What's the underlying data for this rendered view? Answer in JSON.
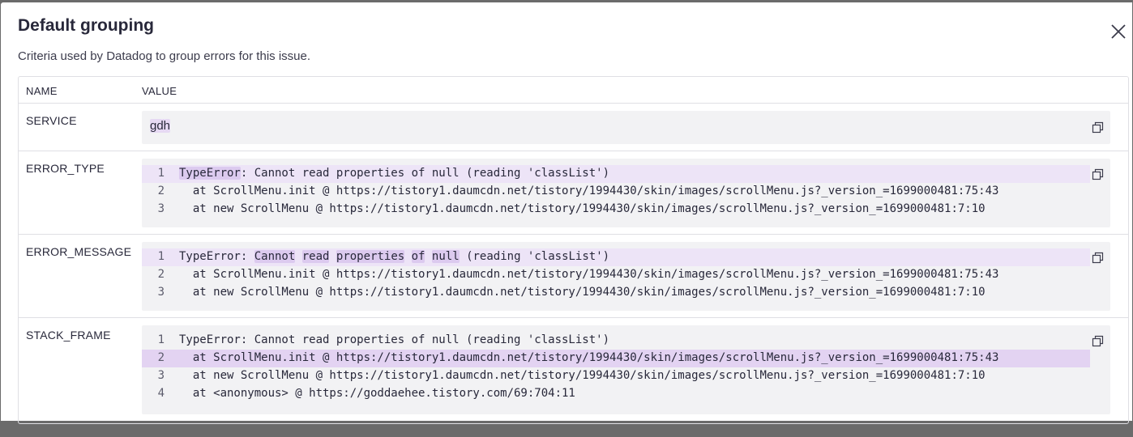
{
  "modal": {
    "title": "Default grouping",
    "subtitle": "Criteria used by Datadog to group errors for this issue.",
    "close_icon": "close-icon"
  },
  "table": {
    "headers": {
      "name": "NAME",
      "value": "VALUE"
    },
    "rows": [
      {
        "name": "SERVICE",
        "value": "gdh",
        "highlight": true
      },
      {
        "name": "ERROR_TYPE",
        "lines": [
          {
            "n": "1",
            "pre": "",
            "hl": "TypeError",
            "post": ": Cannot read properties of null (reading 'classList')",
            "active": true
          },
          {
            "n": "2",
            "text": "  at ScrollMenu.init @ https://tistory1.daumcdn.net/tistory/1994430/skin/images/scrollMenu.js?_version_=1699000481:75:43"
          },
          {
            "n": "3",
            "text": "  at new ScrollMenu @ https://tistory1.daumcdn.net/tistory/1994430/skin/images/scrollMenu.js?_version_=1699000481:7:10"
          }
        ]
      },
      {
        "name": "ERROR_MESSAGE",
        "lines": [
          {
            "n": "1",
            "seg": [
              "TypeError: ",
              "Cannot",
              " ",
              "read",
              " ",
              "properties",
              " ",
              "of",
              " ",
              "null",
              " (reading 'classList')"
            ],
            "active": true
          },
          {
            "n": "2",
            "text": "  at ScrollMenu.init @ https://tistory1.daumcdn.net/tistory/1994430/skin/images/scrollMenu.js?_version_=1699000481:75:43"
          },
          {
            "n": "3",
            "text": "  at new ScrollMenu @ https://tistory1.daumcdn.net/tistory/1994430/skin/images/scrollMenu.js?_version_=1699000481:7:10"
          }
        ]
      },
      {
        "name": "STACK_FRAME",
        "lines": [
          {
            "n": "1",
            "text": "TypeError: Cannot read properties of null (reading 'classList')"
          },
          {
            "n": "2",
            "text": "  at ScrollMenu.init @ https://tistory1.daumcdn.net/tistory/1994430/skin/images/scrollMenu.js?_version_=1699000481:75:43",
            "strong": true
          },
          {
            "n": "3",
            "text": "  at new ScrollMenu @ https://tistory1.daumcdn.net/tistory/1994430/skin/images/scrollMenu.js?_version_=1699000481:7:10"
          },
          {
            "n": "4",
            "text": "  at <anonymous> @ https://goddaehee.tistory.com/69:704:11"
          }
        ]
      }
    ]
  },
  "icons": {
    "copy": "copy-icon"
  },
  "colors": {
    "highlight": "#e6d9f3",
    "active_line": "#ede4f7",
    "code_bg": "#f2f2f4"
  }
}
